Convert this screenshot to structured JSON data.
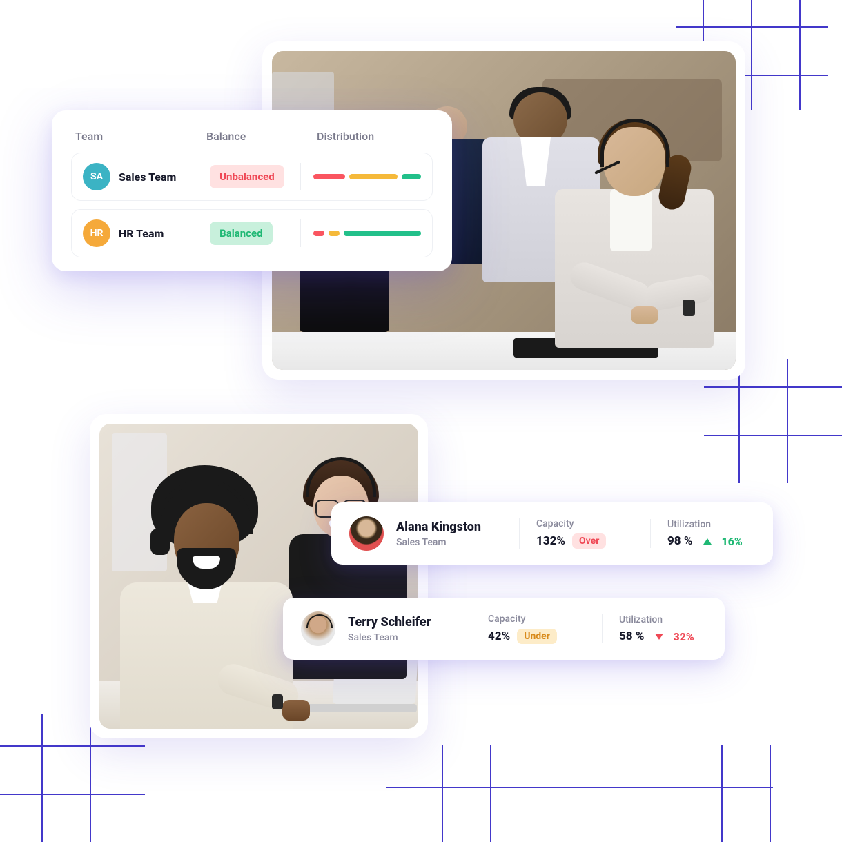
{
  "team_table": {
    "headers": {
      "team": "Team",
      "balance": "Balance",
      "distribution": "Distribution"
    },
    "rows": [
      {
        "avatar_initials": "SA",
        "avatar_color": "teal",
        "name": "Sales Team",
        "balance_label": "Unbalanced",
        "balance_state": "unbalanced",
        "distribution": [
          {
            "color": "red",
            "weight": 30
          },
          {
            "color": "yellow",
            "weight": 45
          },
          {
            "color": "green",
            "weight": 18
          }
        ]
      },
      {
        "avatar_initials": "HR",
        "avatar_color": "orange",
        "name": "HR Team",
        "balance_label": "Balanced",
        "balance_state": "balanced",
        "distribution": [
          {
            "color": "red",
            "weight": 10
          },
          {
            "color": "yellow",
            "weight": 10
          },
          {
            "color": "green",
            "weight": 72
          }
        ]
      }
    ]
  },
  "people": [
    {
      "name": "Alana Kingston",
      "team": "Sales Team",
      "capacity_label": "Capacity",
      "capacity_pct": "132%",
      "capacity_state_label": "Over",
      "capacity_state": "over",
      "utilization_label": "Utilization",
      "utilization_pct": "98 %",
      "utilization_delta": "16%",
      "utilization_direction": "up"
    },
    {
      "name": "Terry Schleifer",
      "team": "Sales Team",
      "capacity_label": "Capacity",
      "capacity_pct": "42%",
      "capacity_state_label": "Under",
      "capacity_state": "under",
      "utilization_label": "Utilization",
      "utilization_pct": "58 %",
      "utilization_delta": "32%",
      "utilization_direction": "down"
    }
  ],
  "colors": {
    "accent": "#4338ca",
    "red": "#fa5560",
    "yellow": "#f5b93a",
    "green": "#22c08a"
  }
}
